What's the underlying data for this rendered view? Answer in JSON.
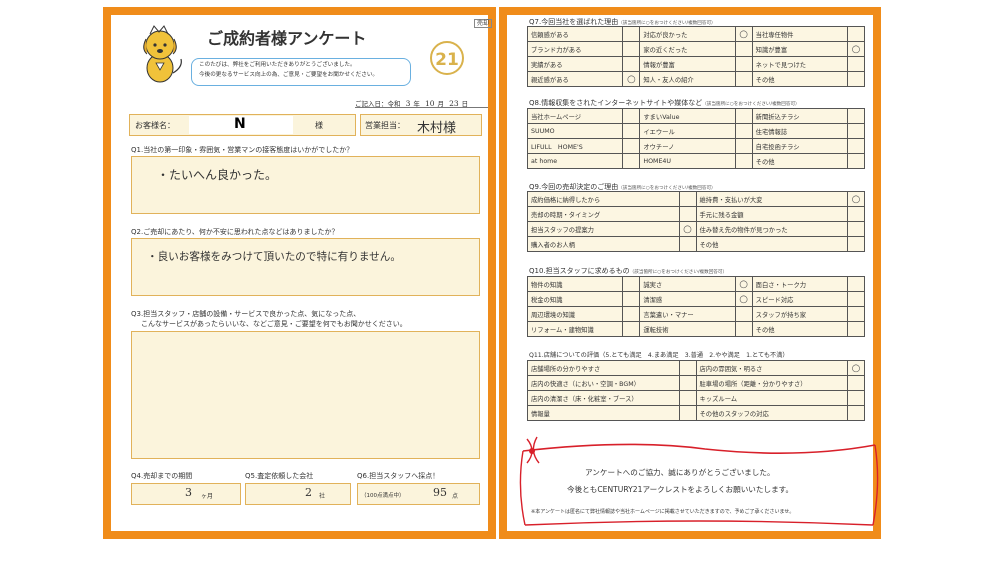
{
  "left": {
    "stamp": "売却",
    "title": "ご成約者様アンケート",
    "intro_line1": "このたびは、弊社をご利用いただきありがとうございました。",
    "intro_line2": "今後の更なるサービス向上の為、ご意見・ご要望をお聞かせください。",
    "logo": "21",
    "date_label": "ご記入日：令和",
    "date_year": "3",
    "date_year_unit": "年",
    "date_month": "10",
    "date_month_unit": "月",
    "date_day": "23",
    "date_day_unit": "日",
    "customer_label": "お客様名：",
    "customer_name": "N",
    "customer_suffix": "様",
    "staff_label": "営業担当：",
    "staff_name": "木村様",
    "q1": "Q1.当社の第一印象・雰囲気・営業マンの接客態度はいかがでしたか？",
    "a1": "・たいへん良かった。",
    "q2": "Q2.ご売却にあたり、何か不安に思われた点などはありましたか？",
    "a2": "・良いお客様をみつけて頂いたので特に有りません。",
    "q3_line1": "Q3.担当スタッフ・店舗の設備・サービスで良かった点、気になった点、",
    "q3_line2": "こんなサービスがあったらいいな、などご意見・ご要望を何でもお聞かせください。",
    "a3": "",
    "q4": "Q4.売却までの期間",
    "a4_value": "3",
    "a4_unit": "ヶ月",
    "q5": "Q5.査定依頼した会社",
    "a5_value": "2",
    "a5_unit": "社",
    "q6": "Q6.担当スタッフへ採点！",
    "a6_note": "（100点満点中）",
    "a6_value": "95",
    "a6_unit": "点"
  },
  "right": {
    "q7": {
      "title": "Q7.今回当社を選ばれた理由",
      "note": "（該当箇所に○をおつけください/複数回答可）",
      "rows": [
        [
          "信頼感がある",
          "",
          "対応が良かった",
          "○",
          "当社専任物件",
          ""
        ],
        [
          "ブランド力がある",
          "",
          "家の近くだった",
          "",
          "知識が豊富",
          "○"
        ],
        [
          "実績がある",
          "",
          "情報が豊富",
          "",
          "ネットで見つけた",
          ""
        ],
        [
          "親近感がある",
          "○",
          "知人・友人の紹介",
          "",
          "その他",
          ""
        ]
      ]
    },
    "q8": {
      "title": "Q8.情報収集をされたインターネットサイトや媒体など",
      "note": "（該当箇所に○をおつけください/複数回答可）",
      "rows": [
        [
          "当社ホームページ",
          "",
          "すまいValue",
          "",
          "新聞折込チラシ",
          ""
        ],
        [
          "SUUMO",
          "",
          "イエウール",
          "",
          "住宅情報誌",
          ""
        ],
        [
          "LIFULL　HOME'S",
          "",
          "オウチーノ",
          "",
          "自宅投函チラシ",
          ""
        ],
        [
          "at home",
          "",
          "HOME4U",
          "",
          "その他",
          ""
        ]
      ]
    },
    "q9": {
      "title": "Q9.今回の売却決定のご理由",
      "note": "（該当箇所に○をおつけください/複数回答可）",
      "rows": [
        [
          "成約価格に納得したから",
          "",
          "維持費・支払いが大変",
          "○"
        ],
        [
          "売却の時期・タイミング",
          "",
          "手元に残る金額",
          ""
        ],
        [
          "担当スタッフの提案力",
          "○",
          "住み替え先の物件が見つかった",
          ""
        ],
        [
          "購入者のお人柄",
          "",
          "その他",
          ""
        ]
      ]
    },
    "q10": {
      "title": "Q10.担当スタッフに求めるもの",
      "note": "（該当箇所に○をおつけください/複数回答可）",
      "rows": [
        [
          "物件の知識",
          "",
          "誠実さ",
          "○",
          "面白さ・トーク力",
          ""
        ],
        [
          "税金の知識",
          "",
          "清潔感",
          "○",
          "スピード対応",
          ""
        ],
        [
          "周辺環境の知識",
          "",
          "言葉遣い・マナー",
          "",
          "スタッフが持ち家",
          ""
        ],
        [
          "リフォーム・建物知識",
          "",
          "運転技術",
          "",
          "その他",
          ""
        ]
      ]
    },
    "q11": {
      "title": "Q11.店舗についての評価（5.とても満足　4.まあ満足　3.普通　2.やや満足　1.とても不満）",
      "rows": [
        [
          "店舗場所の分かりやすさ",
          "",
          "店内の雰囲気・明るさ",
          "○"
        ],
        [
          "店内の快適さ（におい・空調・BGM）",
          "",
          "駐車場の場所（距離・分かりやすさ）",
          ""
        ],
        [
          "店内の清潔さ（床・化粧室・ブース）",
          "",
          "キッズルーム",
          ""
        ],
        [
          "情報量",
          "",
          "その他のスタッフの対応",
          ""
        ]
      ]
    },
    "thanks_line1": "アンケートへのご協力、誠にありがとうございました。",
    "thanks_line2": "今後ともCENTURY21アークレストをよろしくお願いいたします。",
    "thanks_note": "※本アンケートは匿名にて弊社情報誌や当社ホームページに掲載させていただきますので、予めご了承くださいませ。"
  },
  "colors": {
    "frame": "#f08c1a",
    "answer_fill": "#fbf4dc",
    "logo": "#d9b24c",
    "ribbon": "#d8202a"
  }
}
